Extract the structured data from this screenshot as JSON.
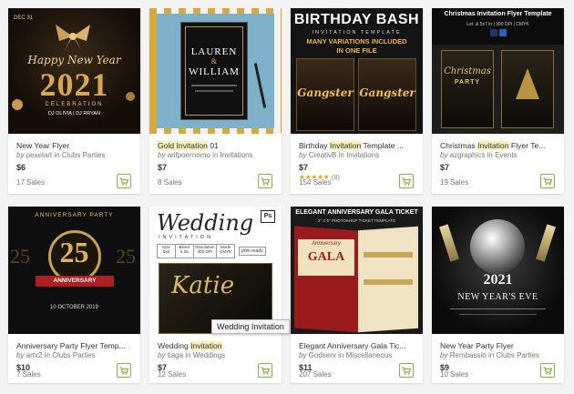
{
  "items": [
    {
      "title_pre": "New Year Flyer",
      "title_hl": "",
      "title_post": "",
      "author": "pexelart",
      "category": "Clubs Parties",
      "price": "$6",
      "rating_count": "",
      "sales": "17 Sales",
      "thumb": {
        "top": "DEC 31",
        "line1": "Happy New Year",
        "line2": "2021",
        "line3": "CELEBRATION",
        "line4": "DJ OLIVIA | DJ RRYAN"
      }
    },
    {
      "title_pre": "",
      "title_hl": "Gold Invitation",
      "title_post": " 01",
      "author": "arifpoernomo",
      "category": "Invitations",
      "price": "$7",
      "rating_count": "",
      "sales": "8 Sales",
      "thumb": {
        "line1": "LAUREN",
        "line2": "&",
        "line3": "WILLIAM"
      }
    },
    {
      "title_pre": "Birthday ",
      "title_hl": "Invitation",
      "title_post": " Template ...",
      "author": "CreativB",
      "category": "Invitations",
      "price": "$7",
      "rating_count": "(8)",
      "sales": "154 Sales",
      "thumb": {
        "line1": "BIRTHDAY BASH",
        "line2": "INVITATION TEMPLATE",
        "line3": "MANY VARIATIONS INCLUDED",
        "line4": "IN ONE FILE",
        "line5": "Gangster"
      }
    },
    {
      "title_pre": "Christmas ",
      "title_hl": "Invitation",
      "title_post": " Flyer Te...",
      "author": "azgraphics",
      "category": "Events",
      "price": "$7",
      "rating_count": "",
      "sales": "19 Sales",
      "thumb": {
        "line1": "Christmas Invitation Flyer Template",
        "line2": "Let. & 5x7 in | 300 DPI | CMYK",
        "line3": "Christmas",
        "line4": "PARTY"
      }
    },
    {
      "title_pre": "Anniversary Party Flyer Temp...",
      "title_hl": "",
      "title_post": "",
      "author": "artx2",
      "category": "Clubs Parties",
      "price": "$10",
      "rating_count": "",
      "sales": "7 Sales",
      "thumb": {
        "line1": "ANNIVERSARY PARTY",
        "line2": "25",
        "line3": "ANNIVERSARY",
        "line4": "10 OCTOBER 2019"
      }
    },
    {
      "title_pre": "Wedding ",
      "title_hl": "Invitation",
      "title_post": "",
      "author": "tiaga",
      "category": "Weddings",
      "price": "$7",
      "rating_count": "",
      "sales": "12 Sales",
      "thumb": {
        "line1": "Wedding",
        "line2": "INVITATION",
        "ps": "Ps",
        "line3": "Katie",
        "line4": "print ready",
        "spec_heads": [
          "Size",
          "Bleed",
          "Resolution",
          "Mode"
        ],
        "spec_vals": [
          "6x6",
          "0.25",
          "300 DPI",
          "CMYK"
        ]
      }
    },
    {
      "title_pre": "Elegant Anniversary Gala Tic...",
      "title_hl": "",
      "title_post": "",
      "author": "Godserv",
      "category": "Miscellaneous",
      "price": "$11",
      "rating_count": "",
      "sales": "207 Sales",
      "thumb": {
        "line1": "ELEGANT ANNIVERSARY GALA TICKET",
        "line2": "2\" X 6\" PHOTOSHOP TICKET TEMPLATE",
        "line3": "GALA",
        "line4": "Anniversary"
      }
    },
    {
      "title_pre": "New Year Party Flyer",
      "title_hl": "",
      "title_post": "",
      "author": "Rembassio",
      "category": "Clubs Parties",
      "price": "$9",
      "rating_count": "",
      "sales": "10 Sales",
      "thumb": {
        "line1": "2021",
        "line2": "NEW YEAR'S EVE"
      }
    }
  ],
  "by_word": "by",
  "in_word": "in",
  "tooltip": "Wedding Invitation",
  "colors": {
    "accent_green": "#82b541",
    "highlight": "#f8f0b8",
    "star": "#e9a300"
  }
}
